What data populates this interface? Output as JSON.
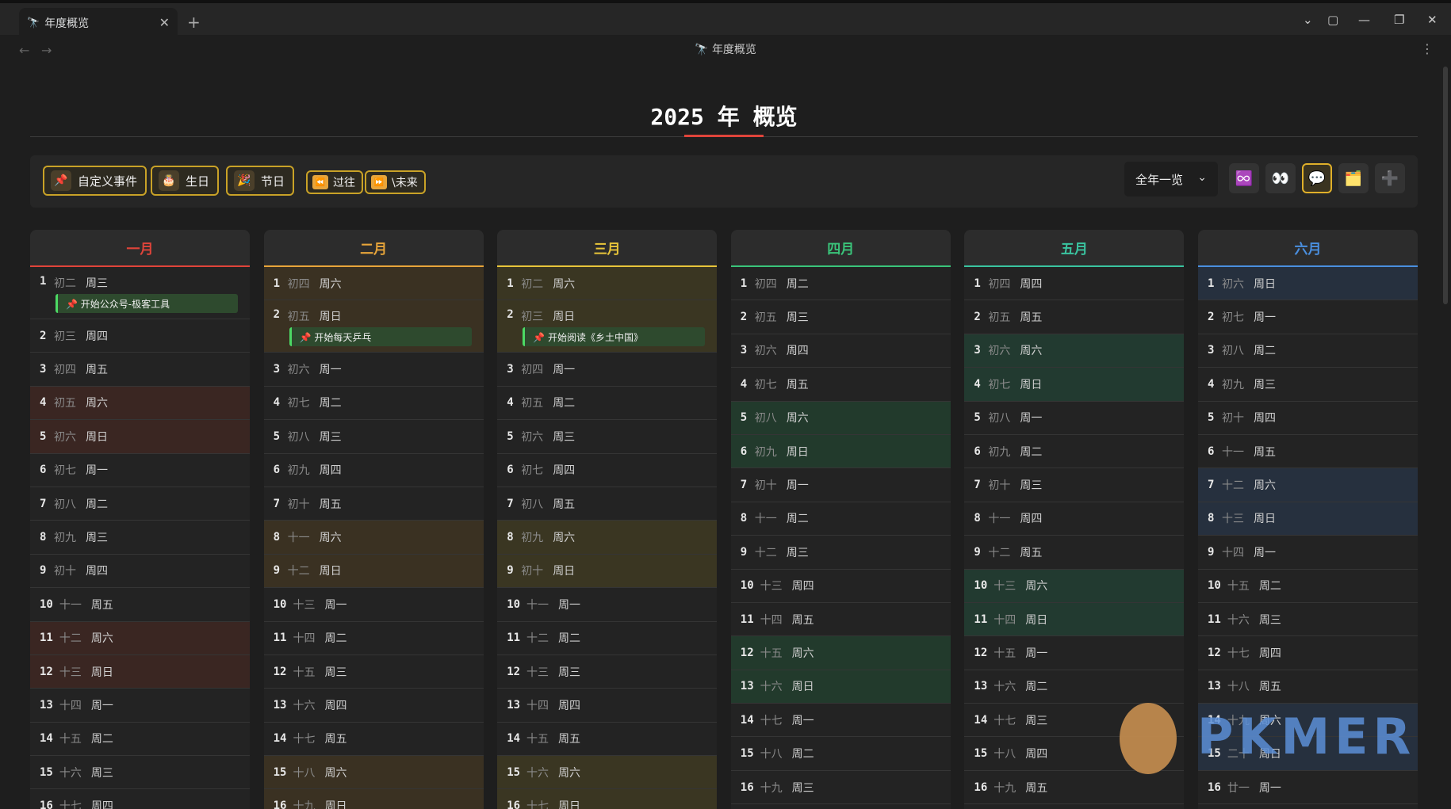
{
  "tab": {
    "icon": "🔭",
    "title": "年度概览",
    "close": "✕",
    "new": "+"
  },
  "nav": {
    "back": "←",
    "forward": "→",
    "view_title": "年度概览",
    "view_icon": "🔭",
    "more": "⋮"
  },
  "window_controls": {
    "chevron": "⌄",
    "sidebar": "▢",
    "minimize": "—",
    "restore": "❐",
    "close": "✕"
  },
  "page": {
    "title": "2025 年 概览"
  },
  "toolbar": {
    "custom_event": {
      "icon": "📌",
      "label": "自定义事件"
    },
    "birthday": {
      "icon": "🎂",
      "label": "生日"
    },
    "holiday": {
      "icon": "🎉",
      "label": "节日"
    },
    "past": {
      "icon": "⏪",
      "label": "过往"
    },
    "future": {
      "icon": "⏩",
      "label": "\\未来"
    },
    "view_select": "全年一览",
    "icons": [
      "♾️",
      "👀",
      "💬",
      "🗂️",
      "➕"
    ]
  },
  "months": [
    {
      "name": "一月",
      "color": "#e0443a",
      "days": [
        {
          "d": "1",
          "lunar": "初二",
          "week": "周三",
          "event": "📌 开始公众号-极客工具"
        },
        {
          "d": "2",
          "lunar": "初三",
          "week": "周四"
        },
        {
          "d": "3",
          "lunar": "初四",
          "week": "周五"
        },
        {
          "d": "4",
          "lunar": "初五",
          "week": "周六",
          "weekend": true
        },
        {
          "d": "5",
          "lunar": "初六",
          "week": "周日",
          "weekend": true
        },
        {
          "d": "6",
          "lunar": "初七",
          "week": "周一"
        },
        {
          "d": "7",
          "lunar": "初八",
          "week": "周二"
        },
        {
          "d": "8",
          "lunar": "初九",
          "week": "周三"
        },
        {
          "d": "9",
          "lunar": "初十",
          "week": "周四"
        },
        {
          "d": "10",
          "lunar": "十一",
          "week": "周五"
        },
        {
          "d": "11",
          "lunar": "十二",
          "week": "周六",
          "weekend": true
        },
        {
          "d": "12",
          "lunar": "十三",
          "week": "周日",
          "weekend": true
        },
        {
          "d": "13",
          "lunar": "十四",
          "week": "周一"
        },
        {
          "d": "14",
          "lunar": "十五",
          "week": "周二"
        },
        {
          "d": "15",
          "lunar": "十六",
          "week": "周三"
        },
        {
          "d": "16",
          "lunar": "十七",
          "week": "周四"
        }
      ]
    },
    {
      "name": "二月",
      "color": "#e8a53a",
      "days": [
        {
          "d": "1",
          "lunar": "初四",
          "week": "周六",
          "weekend": true
        },
        {
          "d": "2",
          "lunar": "初五",
          "week": "周日",
          "weekend": true,
          "event": "📌 开始每天乒乓"
        },
        {
          "d": "3",
          "lunar": "初六",
          "week": "周一"
        },
        {
          "d": "4",
          "lunar": "初七",
          "week": "周二"
        },
        {
          "d": "5",
          "lunar": "初八",
          "week": "周三"
        },
        {
          "d": "6",
          "lunar": "初九",
          "week": "周四"
        },
        {
          "d": "7",
          "lunar": "初十",
          "week": "周五"
        },
        {
          "d": "8",
          "lunar": "十一",
          "week": "周六",
          "weekend": true
        },
        {
          "d": "9",
          "lunar": "十二",
          "week": "周日",
          "weekend": true
        },
        {
          "d": "10",
          "lunar": "十三",
          "week": "周一"
        },
        {
          "d": "11",
          "lunar": "十四",
          "week": "周二"
        },
        {
          "d": "12",
          "lunar": "十五",
          "week": "周三"
        },
        {
          "d": "13",
          "lunar": "十六",
          "week": "周四"
        },
        {
          "d": "14",
          "lunar": "十七",
          "week": "周五"
        },
        {
          "d": "15",
          "lunar": "十八",
          "week": "周六",
          "weekend": true
        },
        {
          "d": "16",
          "lunar": "十九",
          "week": "周日",
          "weekend": true
        }
      ]
    },
    {
      "name": "三月",
      "color": "#e8c53a",
      "days": [
        {
          "d": "1",
          "lunar": "初二",
          "week": "周六",
          "weekend": true
        },
        {
          "d": "2",
          "lunar": "初三",
          "week": "周日",
          "weekend": true,
          "event": "📌 开始阅读《乡土中国》"
        },
        {
          "d": "3",
          "lunar": "初四",
          "week": "周一"
        },
        {
          "d": "4",
          "lunar": "初五",
          "week": "周二"
        },
        {
          "d": "5",
          "lunar": "初六",
          "week": "周三"
        },
        {
          "d": "6",
          "lunar": "初七",
          "week": "周四"
        },
        {
          "d": "7",
          "lunar": "初八",
          "week": "周五"
        },
        {
          "d": "8",
          "lunar": "初九",
          "week": "周六",
          "weekend": true
        },
        {
          "d": "9",
          "lunar": "初十",
          "week": "周日",
          "weekend": true
        },
        {
          "d": "10",
          "lunar": "十一",
          "week": "周一"
        },
        {
          "d": "11",
          "lunar": "十二",
          "week": "周二"
        },
        {
          "d": "12",
          "lunar": "十三",
          "week": "周三"
        },
        {
          "d": "13",
          "lunar": "十四",
          "week": "周四"
        },
        {
          "d": "14",
          "lunar": "十五",
          "week": "周五"
        },
        {
          "d": "15",
          "lunar": "十六",
          "week": "周六",
          "weekend": true
        },
        {
          "d": "16",
          "lunar": "十七",
          "week": "周日",
          "weekend": true
        }
      ]
    },
    {
      "name": "四月",
      "color": "#3ac47a",
      "days": [
        {
          "d": "1",
          "lunar": "初四",
          "week": "周二"
        },
        {
          "d": "2",
          "lunar": "初五",
          "week": "周三"
        },
        {
          "d": "3",
          "lunar": "初六",
          "week": "周四"
        },
        {
          "d": "4",
          "lunar": "初七",
          "week": "周五"
        },
        {
          "d": "5",
          "lunar": "初八",
          "week": "周六",
          "weekend": true
        },
        {
          "d": "6",
          "lunar": "初九",
          "week": "周日",
          "weekend": true
        },
        {
          "d": "7",
          "lunar": "初十",
          "week": "周一"
        },
        {
          "d": "8",
          "lunar": "十一",
          "week": "周二"
        },
        {
          "d": "9",
          "lunar": "十二",
          "week": "周三"
        },
        {
          "d": "10",
          "lunar": "十三",
          "week": "周四"
        },
        {
          "d": "11",
          "lunar": "十四",
          "week": "周五"
        },
        {
          "d": "12",
          "lunar": "十五",
          "week": "周六",
          "weekend": true
        },
        {
          "d": "13",
          "lunar": "十六",
          "week": "周日",
          "weekend": true
        },
        {
          "d": "14",
          "lunar": "十七",
          "week": "周一"
        },
        {
          "d": "15",
          "lunar": "十八",
          "week": "周二"
        },
        {
          "d": "16",
          "lunar": "十九",
          "week": "周三"
        }
      ]
    },
    {
      "name": "五月",
      "color": "#3ac4a0",
      "days": [
        {
          "d": "1",
          "lunar": "初四",
          "week": "周四"
        },
        {
          "d": "2",
          "lunar": "初五",
          "week": "周五"
        },
        {
          "d": "3",
          "lunar": "初六",
          "week": "周六",
          "weekend": true
        },
        {
          "d": "4",
          "lunar": "初七",
          "week": "周日",
          "weekend": true
        },
        {
          "d": "5",
          "lunar": "初八",
          "week": "周一"
        },
        {
          "d": "6",
          "lunar": "初九",
          "week": "周二"
        },
        {
          "d": "7",
          "lunar": "初十",
          "week": "周三"
        },
        {
          "d": "8",
          "lunar": "十一",
          "week": "周四"
        },
        {
          "d": "9",
          "lunar": "十二",
          "week": "周五"
        },
        {
          "d": "10",
          "lunar": "十三",
          "week": "周六",
          "weekend": true
        },
        {
          "d": "11",
          "lunar": "十四",
          "week": "周日",
          "weekend": true
        },
        {
          "d": "12",
          "lunar": "十五",
          "week": "周一"
        },
        {
          "d": "13",
          "lunar": "十六",
          "week": "周二"
        },
        {
          "d": "14",
          "lunar": "十七",
          "week": "周三"
        },
        {
          "d": "15",
          "lunar": "十八",
          "week": "周四"
        },
        {
          "d": "16",
          "lunar": "十九",
          "week": "周五"
        }
      ]
    },
    {
      "name": "六月",
      "color": "#4a8fe0",
      "days": [
        {
          "d": "1",
          "lunar": "初六",
          "week": "周日",
          "weekend": true
        },
        {
          "d": "2",
          "lunar": "初七",
          "week": "周一"
        },
        {
          "d": "3",
          "lunar": "初八",
          "week": "周二"
        },
        {
          "d": "4",
          "lunar": "初九",
          "week": "周三"
        },
        {
          "d": "5",
          "lunar": "初十",
          "week": "周四"
        },
        {
          "d": "6",
          "lunar": "十一",
          "week": "周五"
        },
        {
          "d": "7",
          "lunar": "十二",
          "week": "周六",
          "weekend": true
        },
        {
          "d": "8",
          "lunar": "十三",
          "week": "周日",
          "weekend": true
        },
        {
          "d": "9",
          "lunar": "十四",
          "week": "周一"
        },
        {
          "d": "10",
          "lunar": "十五",
          "week": "周二"
        },
        {
          "d": "11",
          "lunar": "十六",
          "week": "周三"
        },
        {
          "d": "12",
          "lunar": "十七",
          "week": "周四"
        },
        {
          "d": "13",
          "lunar": "十八",
          "week": "周五"
        },
        {
          "d": "14",
          "lunar": "十九",
          "week": "周六",
          "weekend": true
        },
        {
          "d": "15",
          "lunar": "二十",
          "week": "周日",
          "weekend": true
        },
        {
          "d": "16",
          "lunar": "廿一",
          "week": "周一"
        }
      ]
    }
  ],
  "weekend_colors": [
    "#3a2622",
    "#3a3122",
    "#3a3622",
    "#223a2c",
    "#223a30",
    "#26303e"
  ],
  "watermark": "PKMER"
}
